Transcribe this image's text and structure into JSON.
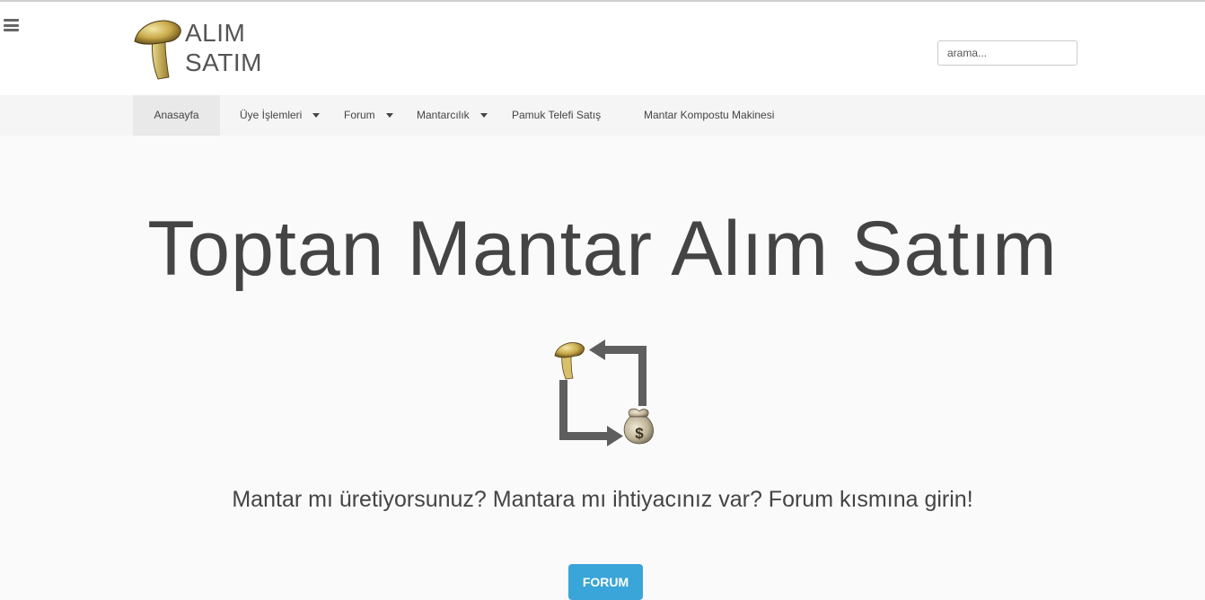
{
  "header": {
    "logo_line1": "ALIM",
    "logo_line2": "SATIM",
    "search_placeholder": "arama..."
  },
  "nav": {
    "items": [
      {
        "label": "Anasayfa",
        "active": true,
        "dropdown": false
      },
      {
        "label": "Üye İşlemleri",
        "active": false,
        "dropdown": true
      },
      {
        "label": "Forum",
        "active": false,
        "dropdown": true
      },
      {
        "label": "Mantarcılık",
        "active": false,
        "dropdown": true
      },
      {
        "label": "Pamuk Telefi Satış",
        "active": false,
        "dropdown": false
      },
      {
        "label": "Mantar Kompostu Makinesi",
        "active": false,
        "dropdown": false
      }
    ]
  },
  "hero": {
    "title": "Toptan Mantar Alım Satım",
    "subtitle": "Mantar mı üretiyorsunuz? Mantara mı ihtiyacınız var? Forum kısmına girin!",
    "button_label": "FORUM",
    "icon_symbol": "$"
  },
  "icons": {
    "menu": "hamburger-icon",
    "logo": "mushroom-logo-icon",
    "exchange": "exchange-arrows-icon"
  },
  "colors": {
    "accent": "#3aa5d8",
    "nav_bg": "#f5f5f5",
    "nav_active": "#e9e9e9",
    "text": "#444444",
    "background": "#fafafa"
  }
}
